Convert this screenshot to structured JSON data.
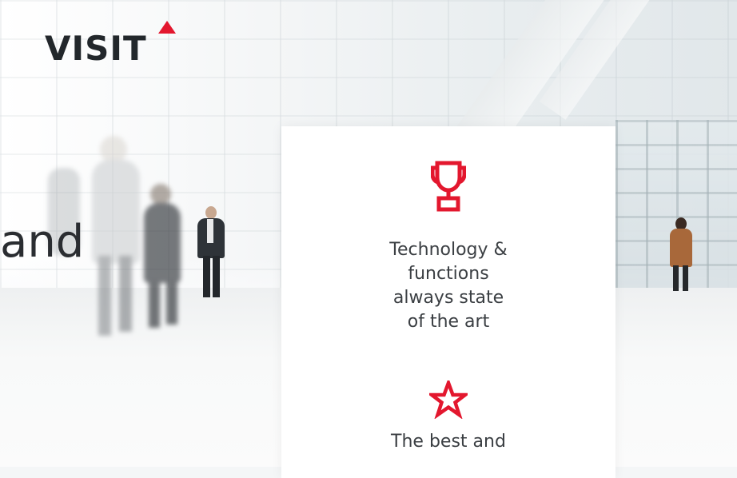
{
  "brand": {
    "logo_text": "VISIT",
    "accent_color": "#e3172e"
  },
  "hero": {
    "headline_fragment": "and"
  },
  "features": [
    {
      "icon": "trophy-icon",
      "text": "Technology &\nfunctions\nalways state\nof the art"
    },
    {
      "icon": "star-icon",
      "text": "The best and"
    }
  ]
}
